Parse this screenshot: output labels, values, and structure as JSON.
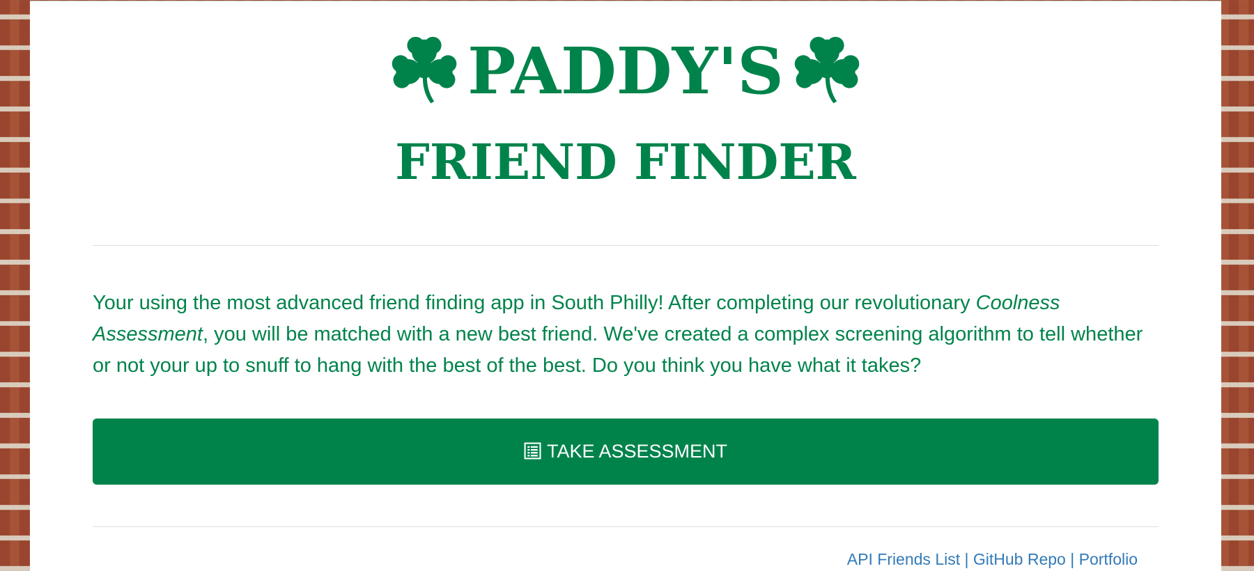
{
  "header": {
    "title_main": "PADDY'S",
    "title_sub": "FRIEND FINDER",
    "decoration_icon": "shamrock-icon",
    "brand_color": "#00834b"
  },
  "intro": {
    "text_before": "Your using the most advanced friend finding app in South Philly! After completing our revolutionary ",
    "emphasis": "Coolness Assessment",
    "text_after": ", you will be matched with a new best friend. We've created a complex screening algorithm to tell whether or not your up to snuff to hang with the best of the best. Do you think you have what it takes?"
  },
  "assessment_button": {
    "icon": "list-alt-icon",
    "label": "TAKE ASSESSMENT"
  },
  "footer": {
    "links": [
      {
        "label": "API Friends List"
      },
      {
        "label": "GitHub Repo"
      },
      {
        "label": "Portfolio"
      }
    ],
    "separator": "|",
    "link_color": "#337ab7"
  },
  "background": {
    "type": "brick wall"
  }
}
